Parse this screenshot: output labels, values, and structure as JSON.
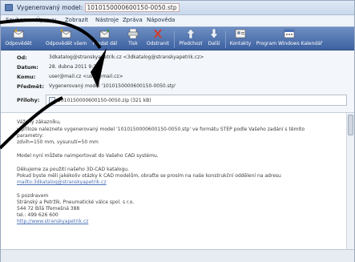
{
  "window": {
    "title_prefix": "Vygenerovaný model: ",
    "title_highlight": "1010150000600150-0050.stp",
    "title_suffix": ""
  },
  "menubar": {
    "items": [
      "Soubor",
      "Úpravy",
      "Zobrazit",
      "Nástroje",
      "Zpráva",
      "Nápověda"
    ]
  },
  "toolbar": {
    "buttons": [
      {
        "label": "Odpovědět",
        "icon": "reply-icon"
      },
      {
        "label": "Odpovědět všem",
        "icon": "reply-all-icon"
      },
      {
        "label": "Předat dál",
        "icon": "forward-icon"
      },
      {
        "label": "Tisk",
        "icon": "print-icon"
      },
      {
        "label": "Odstranit",
        "icon": "delete-icon"
      },
      {
        "label": "Předchozí",
        "icon": "previous-icon"
      },
      {
        "label": "Další",
        "icon": "next-icon"
      },
      {
        "label": "Kontakty",
        "icon": "contacts-icon"
      },
      {
        "label": "Program Windows Kalendář",
        "icon": "calendar-icon"
      }
    ]
  },
  "header": {
    "from_label": "Od:",
    "from_value": "3dkatalog@stranskyapetrik.cz <3dkatalog@stranskyapetrik.cz>",
    "date_label": "Datum:",
    "date_value": "28. dubna 2011 9:38",
    "to_label": "Komu:",
    "to_value": "user@mail.cz <user@mail.cz>",
    "subject_label": "Předmět:",
    "subject_value": "Vygenerovaný model '1010150000600150-0050.stp'",
    "attach_label": "Přílohy:",
    "attach_value": "1010150000600150-0050.zip (321 kB)"
  },
  "body": {
    "greeting": "Vážený zákazníku,",
    "line1": "v příloze naleznete vygenerovaný model '1010150000600150-0050.stp' ve formátu STEP podle Vašeho zadání s těmito",
    "line2": "parametry:",
    "line3": "zdvih=150 mm, vysunutí=50 mm",
    "line4": "Model nyní můžete naimportovat do Vašeho CAD systému.",
    "line5": "Děkujeme za použití našeho 3D-CAD katalogu.",
    "line6": "Pokud byste měli jakékoliv otázky k CAD modelům, obraťte se prosím na naše konstrukční oddělení na adresu",
    "line7_link": "mailto:3dkatalog@stranskyapetrik.cz",
    "line8": "S pozdravem",
    "line9": "Stránský a Petržík, Pneumatické válce spol. s r.o.",
    "line10": "544 72 Bílá Třemešná 388",
    "line11": "tel.: 499 626 600",
    "line12_link": "http://www.stranskyapetrik.cz"
  },
  "colors": {
    "toolbar_top": "#6f8fc3",
    "toolbar_bottom": "#3d61a0",
    "link": "#4a6fb5"
  }
}
